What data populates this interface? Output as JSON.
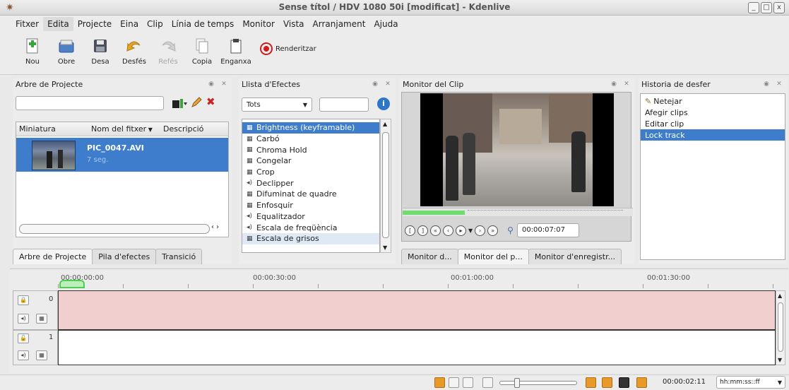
{
  "window": {
    "title": "Sense títol / HDV 1080 50i [modificat] - Kdenlive",
    "btn_minimize": "_",
    "btn_maximize": "□",
    "btn_close": "x"
  },
  "menu": [
    "Fitxer",
    "Edita",
    "Projecte",
    "Eina",
    "Clip",
    "Línia de temps",
    "Monitor",
    "Vista",
    "Arranjament",
    "Ajuda"
  ],
  "toolbar": {
    "new": "Nou",
    "open": "Obre",
    "save": "Desa",
    "undo": "Desfés",
    "redo": "Refés",
    "copy": "Copia",
    "paste": "Enganxa",
    "render": "Renderitzar"
  },
  "project_tree": {
    "title": "Arbre de Projecte",
    "columns": [
      "Miniatura",
      "Nom del fitxer",
      "Descripció"
    ],
    "clip": {
      "name": "PIC_0047.AVI",
      "duration": "7 seg."
    },
    "tabs": [
      "Arbre de Projecte",
      "Pila d'efectes",
      "Transició"
    ]
  },
  "effects": {
    "title": "Llista d'Efectes",
    "filter": "Tots",
    "items": [
      {
        "label": "Brightness (keyframable)",
        "icon": "video-effect-icon"
      },
      {
        "label": "Carbó",
        "icon": "video-effect-icon"
      },
      {
        "label": "Chroma Hold",
        "icon": "video-effect-icon"
      },
      {
        "label": "Congelar",
        "icon": "video-effect-icon"
      },
      {
        "label": "Crop",
        "icon": "video-effect-icon"
      },
      {
        "label": "Declipper",
        "icon": "audio-effect-icon"
      },
      {
        "label": "Difuminat de quadre",
        "icon": "video-effect-icon"
      },
      {
        "label": "Enfosquir",
        "icon": "video-effect-icon"
      },
      {
        "label": "Equalitzador",
        "icon": "audio-effect-icon"
      },
      {
        "label": "Escala de freqüència",
        "icon": "audio-effect-icon"
      },
      {
        "label": "Escala de grisos",
        "icon": "video-effect-icon"
      }
    ]
  },
  "monitor": {
    "title": "Monitor del Clip",
    "timecode": "00:00:07:07",
    "tabs": [
      "Monitor d...",
      "Monitor del p...",
      "Monitor d'enregistr..."
    ]
  },
  "history": {
    "title": "Historia de desfer",
    "items": [
      "Netejar",
      "Afegir clips",
      "Editar clip",
      "Lock track"
    ]
  },
  "timeline": {
    "ruler": [
      "00:00:00:00",
      "00:00:30:00",
      "00:01:00:00",
      "00:01:30:00"
    ],
    "tracks": [
      {
        "number": "0",
        "color": "#f2cfcf"
      },
      {
        "number": "1",
        "color": "#ffffff"
      }
    ]
  },
  "status": {
    "timecode": "00:00:02:11",
    "format": "hh:mm:ss::ff"
  },
  "colors": {
    "selection": "#3d7dcc",
    "video_track": "#f2cfcf",
    "render_red": "#d41a1a"
  }
}
